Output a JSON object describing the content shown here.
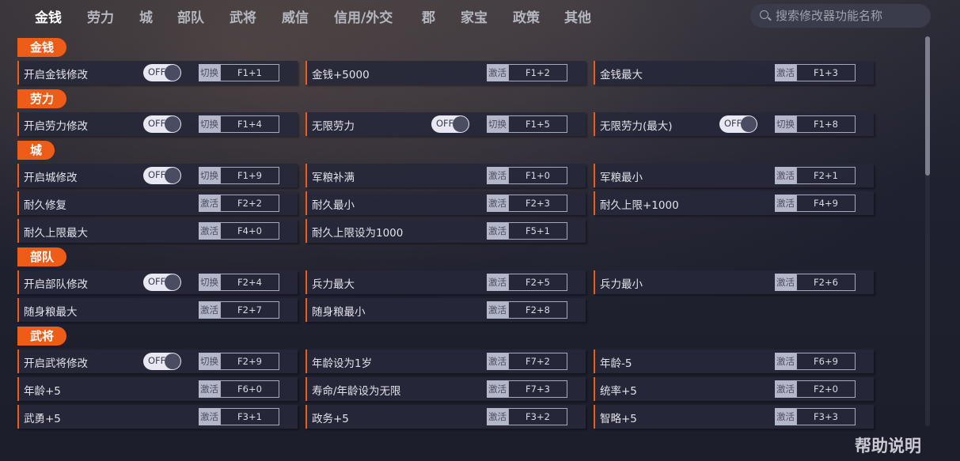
{
  "nav": {
    "items": [
      "金钱",
      "劳力",
      "城",
      "部队",
      "武将",
      "威信",
      "信用/外交",
      "郡",
      "家宝",
      "政策",
      "其他"
    ],
    "active_index": 0
  },
  "search": {
    "placeholder": "搜索修改器功能名称"
  },
  "sections": [
    {
      "title": "金钱",
      "rows": [
        [
          {
            "label": "开启金钱修改",
            "toggle": "OFF",
            "action": "切换",
            "key": "F1+1"
          },
          {
            "label": "金钱+5000",
            "action": "激活",
            "key": "F1+2"
          },
          {
            "label": "金钱最大",
            "action": "激活",
            "key": "F1+3"
          }
        ]
      ]
    },
    {
      "title": "劳力",
      "rows": [
        [
          {
            "label": "开启劳力修改",
            "toggle": "OFF",
            "action": "切换",
            "key": "F1+4"
          },
          {
            "label": "无限劳力",
            "toggle": "OFF",
            "action": "切换",
            "key": "F1+5"
          },
          {
            "label": "无限劳力(最大)",
            "toggle": "OFF",
            "action": "切换",
            "key": "F1+8"
          }
        ]
      ]
    },
    {
      "title": "城",
      "rows": [
        [
          {
            "label": "开启城修改",
            "toggle": "OFF",
            "action": "切换",
            "key": "F1+9"
          },
          {
            "label": "军粮补满",
            "action": "激活",
            "key": "F1+0"
          },
          {
            "label": "军粮最小",
            "action": "激活",
            "key": "F2+1"
          }
        ],
        [
          {
            "label": "耐久修复",
            "action": "激活",
            "key": "F2+2"
          },
          {
            "label": "耐久最小",
            "action": "激活",
            "key": "F2+3"
          },
          {
            "label": "耐久上限+1000",
            "action": "激活",
            "key": "F4+9"
          }
        ],
        [
          {
            "label": "耐久上限最大",
            "action": "激活",
            "key": "F4+0"
          },
          {
            "label": "耐久上限设为1000",
            "action": "激活",
            "key": "F5+1"
          }
        ]
      ]
    },
    {
      "title": "部队",
      "rows": [
        [
          {
            "label": "开启部队修改",
            "toggle": "OFF",
            "action": "切换",
            "key": "F2+4"
          },
          {
            "label": "兵力最大",
            "action": "激活",
            "key": "F2+5"
          },
          {
            "label": "兵力最小",
            "action": "激活",
            "key": "F2+6"
          }
        ],
        [
          {
            "label": "随身粮最大",
            "action": "激活",
            "key": "F2+7"
          },
          {
            "label": "随身粮最小",
            "action": "激活",
            "key": "F2+8"
          }
        ]
      ]
    },
    {
      "title": "武将",
      "rows": [
        [
          {
            "label": "开启武将修改",
            "toggle": "OFF",
            "action": "切换",
            "key": "F2+9"
          },
          {
            "label": "年龄设为1岁",
            "action": "激活",
            "key": "F7+2"
          },
          {
            "label": "年龄-5",
            "action": "激活",
            "key": "F6+9"
          }
        ],
        [
          {
            "label": "年龄+5",
            "action": "激活",
            "key": "F6+0"
          },
          {
            "label": "寿命/年龄设为无限",
            "action": "激活",
            "key": "F7+3"
          },
          {
            "label": "统率+5",
            "action": "激活",
            "key": "F2+0"
          }
        ],
        [
          {
            "label": "武勇+5",
            "action": "激活",
            "key": "F3+1"
          },
          {
            "label": "政务+5",
            "action": "激活",
            "key": "F3+2"
          },
          {
            "label": "智略+5",
            "action": "激活",
            "key": "F3+3"
          }
        ]
      ]
    }
  ],
  "help_label": "帮助说明",
  "colors": {
    "accent": "#ee5d18",
    "background": "#1d1f2c"
  }
}
